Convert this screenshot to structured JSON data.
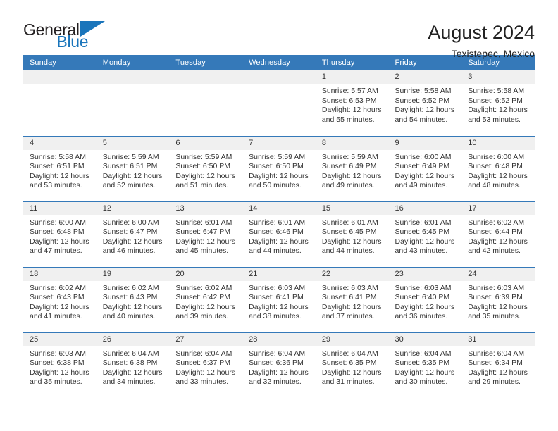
{
  "brand": {
    "name_part1": "General",
    "name_part2": "Blue",
    "accent_color": "#1a75bb"
  },
  "header": {
    "title": "August 2024",
    "subtitle": "Texistepec, Mexico"
  },
  "theme": {
    "header_blue": "#3579b9",
    "daynum_gray": "#f0f0f0",
    "text_color": "#333333"
  },
  "weekday_headers": [
    "Sunday",
    "Monday",
    "Tuesday",
    "Wednesday",
    "Thursday",
    "Friday",
    "Saturday"
  ],
  "weeks": [
    [
      {
        "day": "",
        "empty": true,
        "sunrise": "",
        "sunset": "",
        "daylight_line1": "",
        "daylight_line2": ""
      },
      {
        "day": "",
        "empty": true,
        "sunrise": "",
        "sunset": "",
        "daylight_line1": "",
        "daylight_line2": ""
      },
      {
        "day": "",
        "empty": true,
        "sunrise": "",
        "sunset": "",
        "daylight_line1": "",
        "daylight_line2": ""
      },
      {
        "day": "",
        "empty": true,
        "sunrise": "",
        "sunset": "",
        "daylight_line1": "",
        "daylight_line2": ""
      },
      {
        "day": "1",
        "empty": false,
        "sunrise": "Sunrise: 5:57 AM",
        "sunset": "Sunset: 6:53 PM",
        "daylight_line1": "Daylight: 12 hours",
        "daylight_line2": "and 55 minutes."
      },
      {
        "day": "2",
        "empty": false,
        "sunrise": "Sunrise: 5:58 AM",
        "sunset": "Sunset: 6:52 PM",
        "daylight_line1": "Daylight: 12 hours",
        "daylight_line2": "and 54 minutes."
      },
      {
        "day": "3",
        "empty": false,
        "sunrise": "Sunrise: 5:58 AM",
        "sunset": "Sunset: 6:52 PM",
        "daylight_line1": "Daylight: 12 hours",
        "daylight_line2": "and 53 minutes."
      }
    ],
    [
      {
        "day": "4",
        "empty": false,
        "sunrise": "Sunrise: 5:58 AM",
        "sunset": "Sunset: 6:51 PM",
        "daylight_line1": "Daylight: 12 hours",
        "daylight_line2": "and 53 minutes."
      },
      {
        "day": "5",
        "empty": false,
        "sunrise": "Sunrise: 5:59 AM",
        "sunset": "Sunset: 6:51 PM",
        "daylight_line1": "Daylight: 12 hours",
        "daylight_line2": "and 52 minutes."
      },
      {
        "day": "6",
        "empty": false,
        "sunrise": "Sunrise: 5:59 AM",
        "sunset": "Sunset: 6:50 PM",
        "daylight_line1": "Daylight: 12 hours",
        "daylight_line2": "and 51 minutes."
      },
      {
        "day": "7",
        "empty": false,
        "sunrise": "Sunrise: 5:59 AM",
        "sunset": "Sunset: 6:50 PM",
        "daylight_line1": "Daylight: 12 hours",
        "daylight_line2": "and 50 minutes."
      },
      {
        "day": "8",
        "empty": false,
        "sunrise": "Sunrise: 5:59 AM",
        "sunset": "Sunset: 6:49 PM",
        "daylight_line1": "Daylight: 12 hours",
        "daylight_line2": "and 49 minutes."
      },
      {
        "day": "9",
        "empty": false,
        "sunrise": "Sunrise: 6:00 AM",
        "sunset": "Sunset: 6:49 PM",
        "daylight_line1": "Daylight: 12 hours",
        "daylight_line2": "and 49 minutes."
      },
      {
        "day": "10",
        "empty": false,
        "sunrise": "Sunrise: 6:00 AM",
        "sunset": "Sunset: 6:48 PM",
        "daylight_line1": "Daylight: 12 hours",
        "daylight_line2": "and 48 minutes."
      }
    ],
    [
      {
        "day": "11",
        "empty": false,
        "sunrise": "Sunrise: 6:00 AM",
        "sunset": "Sunset: 6:48 PM",
        "daylight_line1": "Daylight: 12 hours",
        "daylight_line2": "and 47 minutes."
      },
      {
        "day": "12",
        "empty": false,
        "sunrise": "Sunrise: 6:00 AM",
        "sunset": "Sunset: 6:47 PM",
        "daylight_line1": "Daylight: 12 hours",
        "daylight_line2": "and 46 minutes."
      },
      {
        "day": "13",
        "empty": false,
        "sunrise": "Sunrise: 6:01 AM",
        "sunset": "Sunset: 6:47 PM",
        "daylight_line1": "Daylight: 12 hours",
        "daylight_line2": "and 45 minutes."
      },
      {
        "day": "14",
        "empty": false,
        "sunrise": "Sunrise: 6:01 AM",
        "sunset": "Sunset: 6:46 PM",
        "daylight_line1": "Daylight: 12 hours",
        "daylight_line2": "and 44 minutes."
      },
      {
        "day": "15",
        "empty": false,
        "sunrise": "Sunrise: 6:01 AM",
        "sunset": "Sunset: 6:45 PM",
        "daylight_line1": "Daylight: 12 hours",
        "daylight_line2": "and 44 minutes."
      },
      {
        "day": "16",
        "empty": false,
        "sunrise": "Sunrise: 6:01 AM",
        "sunset": "Sunset: 6:45 PM",
        "daylight_line1": "Daylight: 12 hours",
        "daylight_line2": "and 43 minutes."
      },
      {
        "day": "17",
        "empty": false,
        "sunrise": "Sunrise: 6:02 AM",
        "sunset": "Sunset: 6:44 PM",
        "daylight_line1": "Daylight: 12 hours",
        "daylight_line2": "and 42 minutes."
      }
    ],
    [
      {
        "day": "18",
        "empty": false,
        "sunrise": "Sunrise: 6:02 AM",
        "sunset": "Sunset: 6:43 PM",
        "daylight_line1": "Daylight: 12 hours",
        "daylight_line2": "and 41 minutes."
      },
      {
        "day": "19",
        "empty": false,
        "sunrise": "Sunrise: 6:02 AM",
        "sunset": "Sunset: 6:43 PM",
        "daylight_line1": "Daylight: 12 hours",
        "daylight_line2": "and 40 minutes."
      },
      {
        "day": "20",
        "empty": false,
        "sunrise": "Sunrise: 6:02 AM",
        "sunset": "Sunset: 6:42 PM",
        "daylight_line1": "Daylight: 12 hours",
        "daylight_line2": "and 39 minutes."
      },
      {
        "day": "21",
        "empty": false,
        "sunrise": "Sunrise: 6:03 AM",
        "sunset": "Sunset: 6:41 PM",
        "daylight_line1": "Daylight: 12 hours",
        "daylight_line2": "and 38 minutes."
      },
      {
        "day": "22",
        "empty": false,
        "sunrise": "Sunrise: 6:03 AM",
        "sunset": "Sunset: 6:41 PM",
        "daylight_line1": "Daylight: 12 hours",
        "daylight_line2": "and 37 minutes."
      },
      {
        "day": "23",
        "empty": false,
        "sunrise": "Sunrise: 6:03 AM",
        "sunset": "Sunset: 6:40 PM",
        "daylight_line1": "Daylight: 12 hours",
        "daylight_line2": "and 36 minutes."
      },
      {
        "day": "24",
        "empty": false,
        "sunrise": "Sunrise: 6:03 AM",
        "sunset": "Sunset: 6:39 PM",
        "daylight_line1": "Daylight: 12 hours",
        "daylight_line2": "and 35 minutes."
      }
    ],
    [
      {
        "day": "25",
        "empty": false,
        "sunrise": "Sunrise: 6:03 AM",
        "sunset": "Sunset: 6:38 PM",
        "daylight_line1": "Daylight: 12 hours",
        "daylight_line2": "and 35 minutes."
      },
      {
        "day": "26",
        "empty": false,
        "sunrise": "Sunrise: 6:04 AM",
        "sunset": "Sunset: 6:38 PM",
        "daylight_line1": "Daylight: 12 hours",
        "daylight_line2": "and 34 minutes."
      },
      {
        "day": "27",
        "empty": false,
        "sunrise": "Sunrise: 6:04 AM",
        "sunset": "Sunset: 6:37 PM",
        "daylight_line1": "Daylight: 12 hours",
        "daylight_line2": "and 33 minutes."
      },
      {
        "day": "28",
        "empty": false,
        "sunrise": "Sunrise: 6:04 AM",
        "sunset": "Sunset: 6:36 PM",
        "daylight_line1": "Daylight: 12 hours",
        "daylight_line2": "and 32 minutes."
      },
      {
        "day": "29",
        "empty": false,
        "sunrise": "Sunrise: 6:04 AM",
        "sunset": "Sunset: 6:35 PM",
        "daylight_line1": "Daylight: 12 hours",
        "daylight_line2": "and 31 minutes."
      },
      {
        "day": "30",
        "empty": false,
        "sunrise": "Sunrise: 6:04 AM",
        "sunset": "Sunset: 6:35 PM",
        "daylight_line1": "Daylight: 12 hours",
        "daylight_line2": "and 30 minutes."
      },
      {
        "day": "31",
        "empty": false,
        "sunrise": "Sunrise: 6:04 AM",
        "sunset": "Sunset: 6:34 PM",
        "daylight_line1": "Daylight: 12 hours",
        "daylight_line2": "and 29 minutes."
      }
    ]
  ]
}
